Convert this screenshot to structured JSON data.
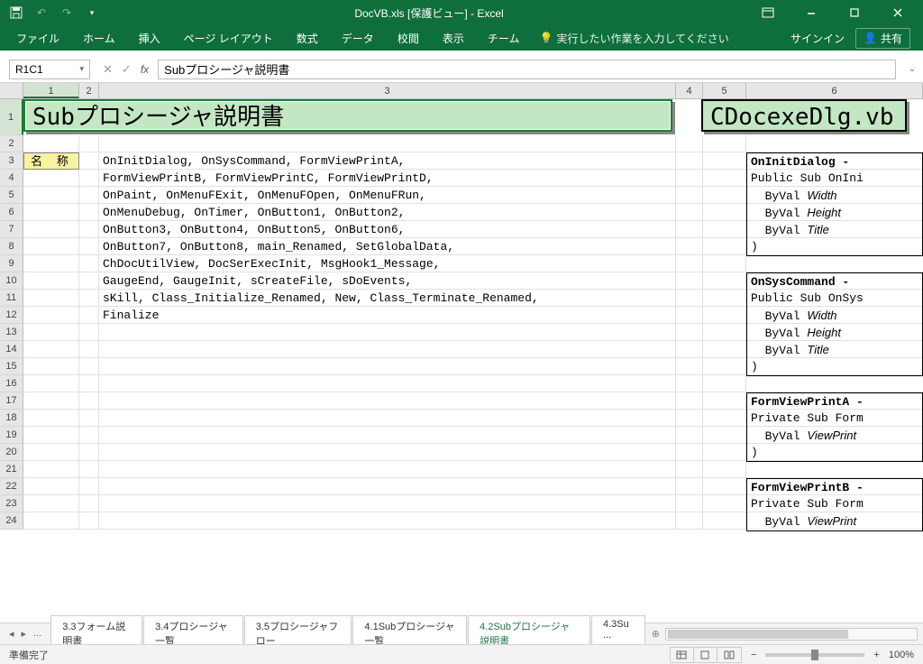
{
  "titlebar": {
    "title": "DocVB.xls  [保護ビュー] - Excel"
  },
  "ribbon": {
    "tabs": [
      "ファイル",
      "ホーム",
      "挿入",
      "ページ レイアウト",
      "数式",
      "データ",
      "校閲",
      "表示",
      "チーム"
    ],
    "tellme": "実行したい作業を入力してください",
    "signin": "サインイン",
    "share": "共有"
  },
  "namebox": "R1C1",
  "formula": "Subプロシージャ説明書",
  "columns": [
    "1",
    "2",
    "3",
    "4",
    "5",
    "6"
  ],
  "sheet": {
    "title_main": "Subプロシージャ説明書",
    "title_side": "CDocexeDlg.vb",
    "label_name": "名 称",
    "rows_left": [
      "OnInitDialog, OnSysCommand, FormViewPrintA,",
      "FormViewPrintB, FormViewPrintC, FormViewPrintD,",
      "OnPaint, OnMenuFExit, OnMenuFOpen, OnMenuFRun,",
      "OnMenuDebug, OnTimer, OnButton1, OnButton2,",
      "OnButton3, OnButton4, OnButton5, OnButton6,",
      "OnButton7, OnButton8, main_Renamed, SetGlobalData,",
      "ChDocUtilView, DocSerExecInit, MsgHook1_Message,",
      "GaugeEnd, GaugeInit, sCreateFile, sDoEvents,",
      "sKill, Class_Initialize_Renamed, New, Class_Terminate_Renamed,",
      "Finalize"
    ],
    "right_blocks": [
      {
        "head": "OnInitDialog - ",
        "lines": [
          "Public Sub OnIni",
          "  ByVal Width  ",
          "  ByVal Height ",
          "  ByVal Title  ",
          ")"
        ],
        "italic_idx": [
          1,
          2,
          3
        ]
      },
      {
        "head": "OnSysCommand - ",
        "lines": [
          "Public Sub OnSys",
          "  ByVal Width  ",
          "  ByVal Height ",
          "  ByVal Title  ",
          ")"
        ],
        "italic_idx": [
          1,
          2,
          3
        ]
      },
      {
        "head": "FormViewPrintA -",
        "lines": [
          "Private Sub Form",
          "  ByVal ViewPrint",
          ")"
        ],
        "italic_idx": [
          1
        ]
      },
      {
        "head": "FormViewPrintB -",
        "lines": [
          "Private Sub Form",
          "  ByVal ViewPrint"
        ],
        "italic_idx": [
          1
        ]
      }
    ]
  },
  "sheet_tabs": {
    "hidden": "...",
    "tabs": [
      "3.3フォーム説明書",
      "3.4プロシージャ一覧",
      "3.5プロシージャフロー",
      "4.1Subプロシージャ一覧",
      "4.2Subプロシージャ説明書",
      "4.3Su ..."
    ],
    "active_index": 4
  },
  "statusbar": {
    "ready": "準備完了",
    "zoom": "100%"
  }
}
